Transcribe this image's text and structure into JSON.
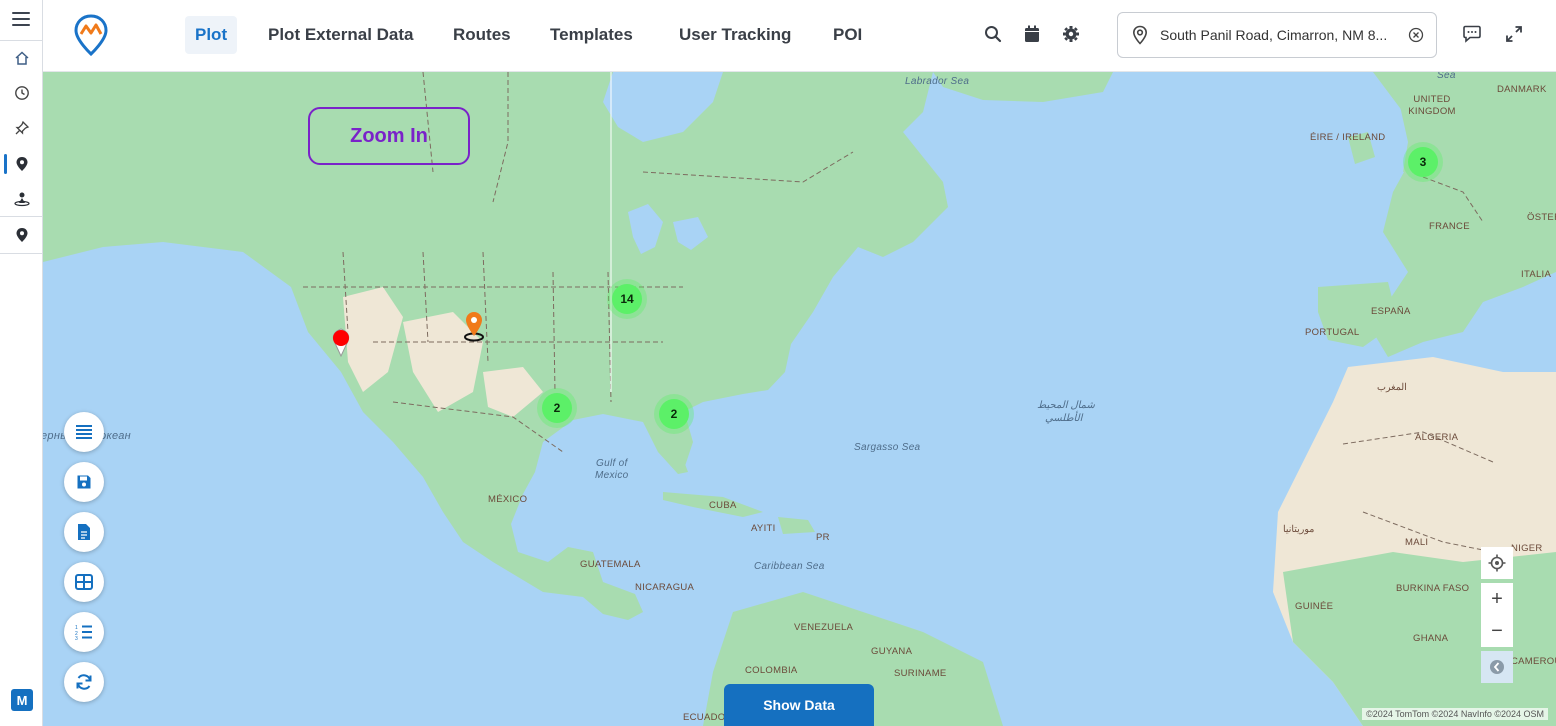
{
  "header": {
    "tabs": [
      {
        "label": "Plot",
        "active": true
      },
      {
        "label": "Plot External Data",
        "active": false
      },
      {
        "label": "Routes",
        "active": false
      },
      {
        "label": "Templates",
        "active": false
      },
      {
        "label": "User Tracking",
        "active": false
      },
      {
        "label": "POI",
        "active": false
      }
    ],
    "icons": [
      "search-icon",
      "calendar-icon",
      "settings-icon",
      "chat-icon",
      "expand-icon"
    ],
    "location_search": {
      "value": "South Panil Road, Cimarron, NM 8..."
    }
  },
  "sidebar": {
    "items": [
      "home-icon",
      "history-icon",
      "pin-icon",
      "location-icon",
      "user-tracking-icon",
      "location-icon"
    ],
    "user_badge": "M"
  },
  "map": {
    "annotation": "Zoom In",
    "clusters": [
      {
        "count": "3"
      },
      {
        "count": "14"
      },
      {
        "count": "2"
      },
      {
        "count": "2"
      }
    ],
    "labels": {
      "labrador_sea": "Labrador Sea",
      "sea_top": "Sea",
      "united_kingdom": "UNITED KINGDOM",
      "eire": "ÉIRE / IRELAND",
      "danmark": "DANMARK",
      "france": "FRANCE",
      "osterreich": "ÖSTER",
      "italia": "ITALIA",
      "espana": "ESPAÑA",
      "portugal": "PORTUGAL",
      "algeria": "ALGERIA",
      "mali": "MALI",
      "niger": "NIGER",
      "burkina_faso": "BURKINA FASO",
      "guinee": "GUINÉE",
      "ghana": "GHANA",
      "cameroun": "CAMEROUN",
      "mauritania_ar": "موريتانيا",
      "maghrib_ar": "المغرب",
      "atlantic_ar_1": "شمال المحيط",
      "atlantic_ar_2": "الأطلسي",
      "sargasso_sea": "Sargasso Sea",
      "gulf_of_mexico_1": "Gulf of",
      "gulf_of_mexico_2": "Mexico",
      "mexico": "MÉXICO",
      "cuba": "CUBA",
      "ayiti": "AYITI",
      "pr": "PR",
      "caribbean_sea": "Caribbean Sea",
      "guatemala": "GUATEMALA",
      "nicaragua": "NICARAGUA",
      "venezuela": "VENEZUELA",
      "guyana": "GUYANA",
      "suriname": "SURINAME",
      "colombia": "COLOMBIA",
      "ecuador": "ECUADOR",
      "pacific_ocean": "ерный  кий океан"
    },
    "fab_icons": [
      "list-icon",
      "save-icon",
      "document-icon",
      "grid-icon",
      "numbered-list-icon",
      "refresh-icon"
    ],
    "controls": {
      "locate": "locate-icon",
      "zoom_in": "+",
      "zoom_out": "−"
    },
    "show_data_label": "Show Data",
    "attribution": "©2024 TomTom ©2024 NavInfo ©2024 OSM"
  }
}
